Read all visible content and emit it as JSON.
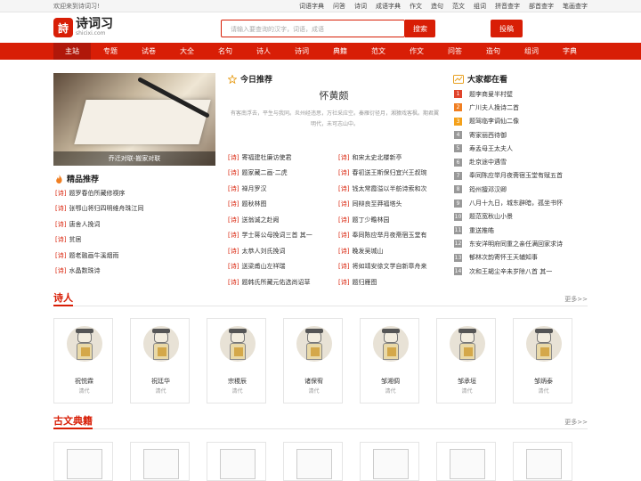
{
  "topbar": {
    "welcome": "欢迎来到诗词习!",
    "links": [
      "词语字典",
      "问答",
      "诗词",
      "成语字典",
      "作文",
      "造句",
      "范文",
      "组词",
      "拼音查字",
      "部首查字",
      "笔画查字"
    ]
  },
  "header": {
    "logo_text": "诗词习",
    "logo_domain": "shicixi.com",
    "search_placeholder": "请输入要查询的汉字，词语，成语",
    "search_button": "搜索",
    "submit_button": "投稿"
  },
  "nav": [
    "主站",
    "专题",
    "试卷",
    "大全",
    "名句",
    "诗人",
    "诗词",
    "典籍",
    "范文",
    "作文",
    "问答",
    "造句",
    "组词",
    "字典"
  ],
  "feature": {
    "caption": "乔迁对联-搬家对联"
  },
  "picks": {
    "title": "精品推荐",
    "tag": "[诗]",
    "items": [
      "题罗春伯所藏修禊序",
      "张鄂山将归四明维舟珠江同",
      "唐舍人挽词",
      "贫居",
      "题老融画牛溪烟雨",
      "水晶数珠诗"
    ]
  },
  "today": {
    "title": "今日推荐",
    "poem_title": "怀黄颇",
    "poem_text": "有客南浮去，平生与我同。炎州经违思，万社采应空。秦雁衍径月，湘猿戏客枫。期君翼明代，未可志山中。",
    "tag": "[诗]",
    "col1": [
      "寄福建杜廉访使君",
      "题家藏二画·二虎",
      "禅月罗汉",
      "题秋林图",
      "送翁诚之赴阙",
      "学士蒋公母挽词三首 其一",
      "太恭人刘氏挽词",
      "送梁甫山左祥瑞",
      "题韩氏所藏元佑选尚诏草"
    ],
    "col2": [
      "和宋太史北楼新亭",
      "春初送王斯保归宜兴王叔琬",
      "钱太常霞溢以半舫诗索和次",
      "同辩良至莽福塔头",
      "题丁少瞻林园",
      "奉同陈应举月夜斋宿玉堂有",
      "晚发吴城山",
      "将如靖安徐文学自新章舟来",
      "题归雁图"
    ]
  },
  "popular": {
    "title": "大家都在看",
    "colors": [
      "#e0442c",
      "#f07f22",
      "#f4a11a",
      "#999999"
    ],
    "items": [
      "题李商叟半村壁",
      "广川夫人挽诗二首",
      "题驾临李调仙二像",
      "寄家丽西待御",
      "寿孟母王太夫人",
      "赴京途中遇雪",
      "奉同陈应举月夜斋宿玉堂有赋五首",
      "筠州擅邓汉卿",
      "八月十九日，城东辟暗，孤坐书怀",
      "题范宽秋山小景",
      "重送推皓",
      "东安洋明府同重之亲任满回家求诗",
      "郁林次韵寄怀王天辅知事",
      "次和王朅尘辛未岁除八首 其一"
    ]
  },
  "poets": {
    "title": "诗人",
    "more": "更多>>",
    "items": [
      {
        "name": "祝悦霖",
        "dynasty": "清代"
      },
      {
        "name": "祝廷华",
        "dynasty": "清代"
      },
      {
        "name": "宗稷辰",
        "dynasty": "清代"
      },
      {
        "name": "诸保宥",
        "dynasty": "清代"
      },
      {
        "name": "邹湘倜",
        "dynasty": "清代"
      },
      {
        "name": "邹承垣",
        "dynasty": "清代"
      },
      {
        "name": "邹炳泰",
        "dynasty": "清代"
      }
    ]
  },
  "classics": {
    "title": "古文典籍",
    "more": "更多>>"
  }
}
